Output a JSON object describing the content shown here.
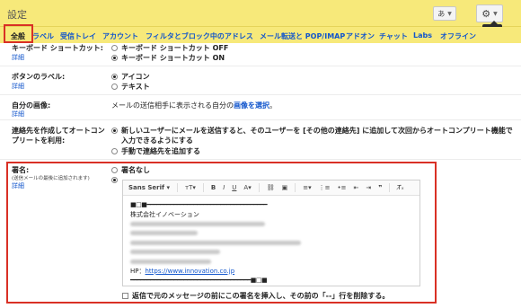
{
  "header": {
    "title": "設定",
    "lang_button": "あ",
    "settings_tooltip": "設定"
  },
  "tabs": [
    {
      "label": "全般",
      "active": true
    },
    {
      "label": "ラベル"
    },
    {
      "label": "受信トレイ"
    },
    {
      "label": "アカウント"
    },
    {
      "label": "フィルタとブロック中のアドレス"
    },
    {
      "label": "メール転送と POP/IMAP"
    },
    {
      "label": "アドオン"
    },
    {
      "label": "チャット"
    },
    {
      "label": "Labs"
    },
    {
      "label": "オフライン"
    }
  ],
  "detail_link": "詳細",
  "shortcuts": {
    "label": "キーボード ショートカット:",
    "options": [
      "キーボード ショートカット OFF",
      "キーボード ショートカット ON"
    ],
    "selected": 1
  },
  "button_labels": {
    "label": "ボタンのラベル:",
    "options": [
      "アイコン",
      "テキスト"
    ],
    "selected": 0
  },
  "my_picture": {
    "label": "自分の画像:",
    "text_before": "メールの送信相手に表示される自分の",
    "link": "画像を選択",
    "text_after": "。"
  },
  "autocomplete": {
    "label_line1": "連絡先を作成してオートコン",
    "label_line2": "プリートを利用:",
    "option1_line1": "新しいユーザーにメールを送信すると、そのユーザーを [その他の連絡先] に追加して次回からオートコンプリート機能で",
    "option1_line2": "入力できるようにする",
    "option2": "手動で連絡先を追加する",
    "selected": 0
  },
  "signature": {
    "label": "署名:",
    "hint": "(送信メールの最後に追加されます)",
    "no_signature": "署名なし",
    "font": "Sans Serif",
    "toolbar_icons": [
      "text-size-icon",
      "bold-icon",
      "italic-icon",
      "underline-icon",
      "text-color-icon",
      "link-icon",
      "image-icon",
      "align-icon",
      "numbered-list-icon",
      "bulleted-list-icon",
      "indent-less-icon",
      "indent-more-icon",
      "quote-icon",
      "remove-formatting-icon"
    ],
    "company": "株式会社イノベーション",
    "hp_label": "HP：",
    "hp_url": "https://www.innovation.co.jp",
    "insert_option": "返信で元のメッセージの前にこの署名を挿入し、その前の「--」行を削除する。"
  }
}
